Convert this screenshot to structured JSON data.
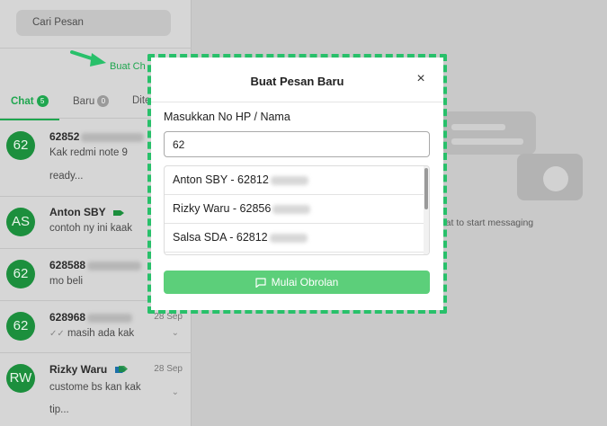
{
  "sidebar": {
    "search_placeholder": "Cari Pesan",
    "new_chat_link": "Buat Ch",
    "tabs": [
      {
        "label": "Chat",
        "count": "5"
      },
      {
        "label": "Baru",
        "count": "0"
      },
      {
        "label": "Dite"
      }
    ],
    "chats": [
      {
        "initials": "62",
        "name": "62852",
        "message": "Kak redmi note 9",
        "message2": "ready...",
        "time": ""
      },
      {
        "initials": "AS",
        "name": "Anton SBY",
        "message": "contoh ny ini kaak",
        "time": ""
      },
      {
        "initials": "62",
        "name": "628588",
        "message": "mo beli",
        "time": ""
      },
      {
        "initials": "62",
        "name": "628968",
        "message": "masih ada kak",
        "time": "28 Sep"
      },
      {
        "initials": "RW",
        "name": "Rizky Waru",
        "message": "custome bs kan kak",
        "message2": "tip...",
        "time": "28 Sep"
      }
    ]
  },
  "main": {
    "empty_hint": "t a chat to start messaging"
  },
  "modal": {
    "title": "Buat Pesan Baru",
    "close_glyph": "×",
    "field_label": "Masukkan No HP / Nama",
    "input_value": "62",
    "suggestions": [
      {
        "label": "Anton SBY - 62812"
      },
      {
        "label": "Rizky Waru - 62856"
      },
      {
        "label": "Salsa SDA - 62812"
      }
    ],
    "start_button": "Mulai Obrolan"
  },
  "colors": {
    "accent": "#1fa64f",
    "highlight": "#28c06a",
    "button": "#5ccf7a"
  }
}
